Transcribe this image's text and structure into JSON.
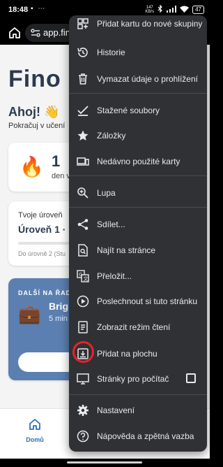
{
  "status_bar": {
    "time": "18:48",
    "notification_icons": "▪ ⋯",
    "net_speed_value": "147",
    "net_speed_unit": "KB/s",
    "battery": "47"
  },
  "browser": {
    "url": "app.fino"
  },
  "page": {
    "brand": "Fino",
    "greeting": "Ahoj! 👋",
    "subtitle": "Pokračuj v učení",
    "streak_icon": "🔥",
    "streak_number": "1",
    "streak_label": "den v",
    "level_title": "Tvoje úroveň",
    "level_name": "Úroveň 1 ·",
    "level_next": "Do úrovně 2 (Stu",
    "next_header": "DALŠÍ NA ŘAD",
    "next_icon": "💼",
    "next_title": "Brig",
    "next_duration": "5 min",
    "nav_home": "Domů"
  },
  "menu": {
    "items": [
      {
        "icon": "add-to-group-icon",
        "label": "Přidat kartu do nové skupiny"
      },
      {
        "icon": "history-icon",
        "label": "Historie"
      },
      {
        "icon": "trash-icon",
        "label": "Vymazat údaje o prohlížení"
      },
      {
        "icon": "downloads-icon",
        "label": "Stažené soubory"
      },
      {
        "icon": "star-icon",
        "label": "Záložky"
      },
      {
        "icon": "devices-icon",
        "label": "Nedávno použité karty"
      },
      {
        "icon": "zoom-icon",
        "label": "Lupa"
      },
      {
        "icon": "share-icon",
        "label": "Sdílet..."
      },
      {
        "icon": "find-in-page-icon",
        "label": "Najít na stránce"
      },
      {
        "icon": "translate-icon",
        "label": "Přeložit..."
      },
      {
        "icon": "play-icon",
        "label": "Poslechnout si tuto stránku"
      },
      {
        "icon": "reader-mode-icon",
        "label": "Zobrazit režim čtení"
      },
      {
        "icon": "add-to-home-icon",
        "label": "Přidat na plochu"
      },
      {
        "icon": "desktop-icon",
        "label": "Stránky pro počítač",
        "checked": false
      },
      {
        "icon": "gear-icon",
        "label": "Nastavení"
      },
      {
        "icon": "help-icon",
        "label": "Nápověda a zpětná vazba"
      }
    ]
  },
  "colors": {
    "menu_bg": "#303134",
    "menu_text": "#e8eaed",
    "highlight_circle": "#e3242b",
    "brand_dark": "#2c3a50",
    "accent_blue": "#5b7fb0"
  }
}
